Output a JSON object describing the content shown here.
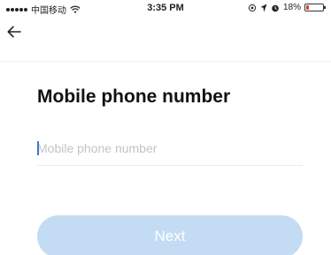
{
  "status_bar": {
    "carrier": "中国移动",
    "time": "3:35 PM",
    "battery_percent": "18%",
    "battery_level": 0.18,
    "battery_color": "#e53935"
  },
  "nav": {
    "back_icon": "arrow-left-icon"
  },
  "main": {
    "title": "Mobile phone number",
    "phone_input": {
      "placeholder": "Mobile phone number",
      "value": ""
    },
    "next_label": "Next",
    "next_button_color": "#c3dcf3"
  }
}
